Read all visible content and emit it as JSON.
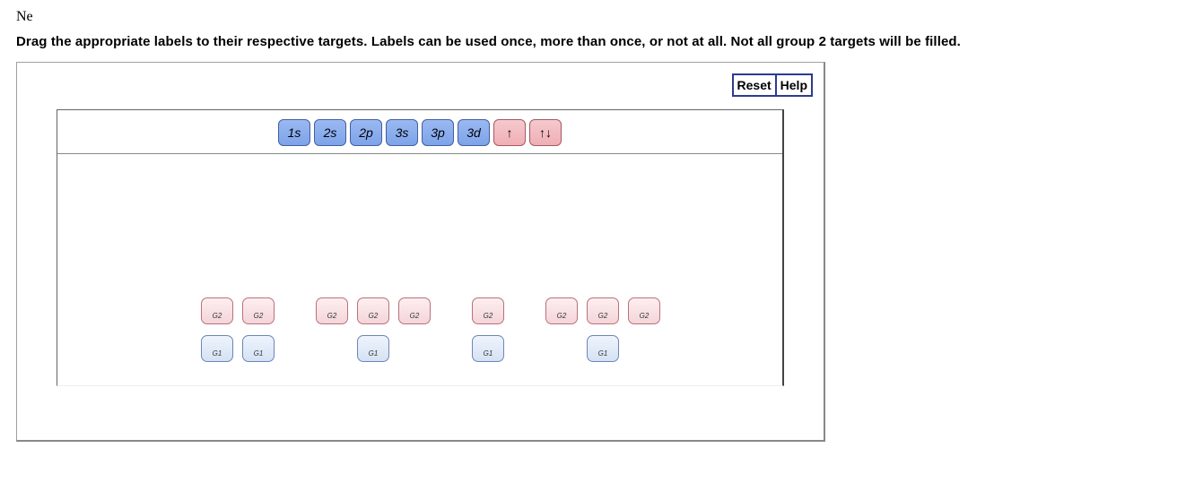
{
  "header_element": "Ne",
  "instructions": "Drag the appropriate labels to their respective targets. Labels can be used once, more than once, or not at all. Not all group 2 targets will be filled.",
  "controls": {
    "reset": "Reset",
    "help": "Help"
  },
  "labels": {
    "orbitals": [
      "1s",
      "2s",
      "2p",
      "3s",
      "3p",
      "3d"
    ],
    "arrows": [
      "↑",
      "↑↓"
    ]
  },
  "targets": {
    "g2_groups": [
      2,
      3,
      1,
      3
    ],
    "g1_layout": [
      {
        "pos": 0,
        "label": "G1"
      },
      {
        "pos": 1,
        "label": "G1"
      },
      {
        "pos": 4,
        "label": "G1"
      },
      {
        "pos": 6,
        "label": "G1"
      },
      {
        "pos": 8,
        "label": "G1"
      }
    ],
    "g2_label": "G2",
    "g1_label": "G1"
  }
}
